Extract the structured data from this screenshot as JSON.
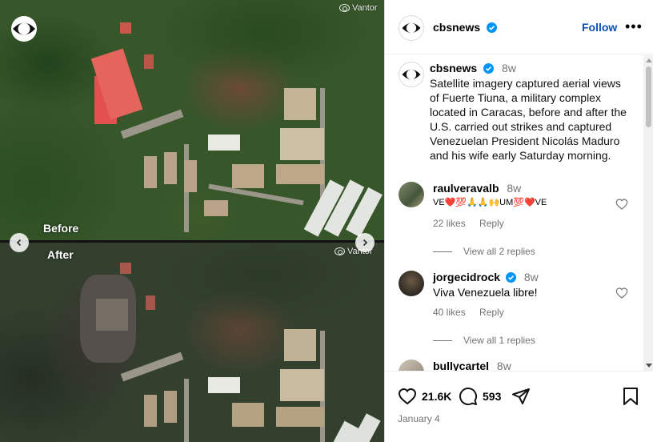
{
  "media": {
    "before_label": "Before",
    "after_label": "After",
    "watermark": "Vantor",
    "prev_icon": "chevron-left-icon",
    "next_icon": "chevron-right-icon",
    "colors": {
      "roof_red": "#e0474a",
      "roof_white": "#e8e8e0",
      "roof_tan": "#b9a48a"
    }
  },
  "post": {
    "username": "cbsnews",
    "verified": true,
    "follow_label": "Follow",
    "more_icon": "more-horizontal-icon",
    "time": "8w",
    "caption": "Satellite imagery captured aerial views of Fuerte Tiuna, a military complex located in Caracas, before and after the U.S. carried out strikes and captured Venezuelan President Nicolás Maduro and his wife early Saturday morning."
  },
  "comments": [
    {
      "username": "raulveravalb",
      "time": "8w",
      "text": "VE❤️💯🙏🙏🙌UM💯❤️VE",
      "likes": "22 likes",
      "reply_label": "Reply",
      "view_replies": "View all 2 replies"
    },
    {
      "username": "jorgecidrock",
      "verified": true,
      "time": "8w",
      "text": "Viva Venezuela libre!",
      "likes": "40 likes",
      "reply_label": "Reply",
      "view_replies": "View all 1 replies"
    },
    {
      "username": "bullycartel",
      "time": "8w"
    }
  ],
  "actions": {
    "likes_count": "21.6K",
    "comments_count": "593",
    "like_icon": "heart-icon",
    "comment_icon": "comment-icon",
    "share_icon": "send-icon",
    "save_icon": "bookmark-icon",
    "date": "January 4"
  },
  "colors": {
    "link": "#0a4ebb",
    "verified": "#0095f6",
    "muted": "#737373"
  }
}
